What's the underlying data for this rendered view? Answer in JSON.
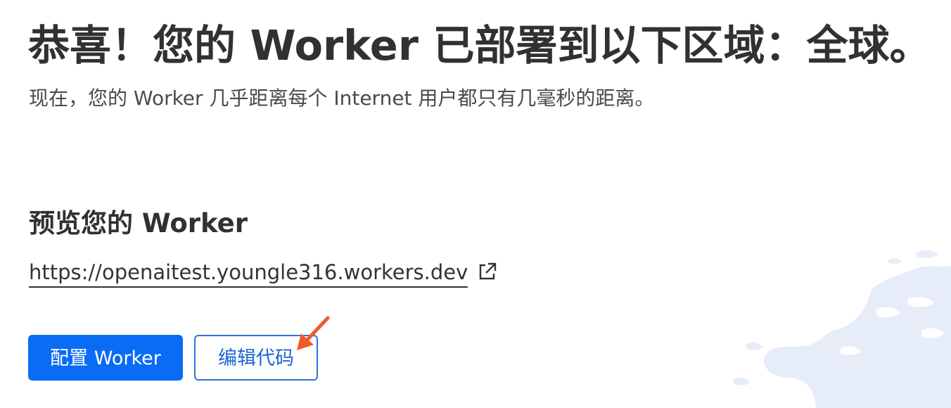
{
  "header": {
    "title": "恭喜！您的 Worker 已部署到以下区域：全球。",
    "subtitle": "现在，您的 Worker 几乎距离每个 Internet 用户都只有几毫秒的距离。"
  },
  "preview": {
    "heading": "预览您的 Worker",
    "url": "https://openaitest.youngle316.workers.dev",
    "external_icon": "external-link-icon"
  },
  "actions": {
    "configure_label": "配置 Worker",
    "edit_code_label": "编辑代码"
  },
  "colors": {
    "primary": "#0a6cf5",
    "secondary_border": "#2f73d8",
    "annotation_arrow": "#f05a28",
    "map": "#e6edf8"
  }
}
